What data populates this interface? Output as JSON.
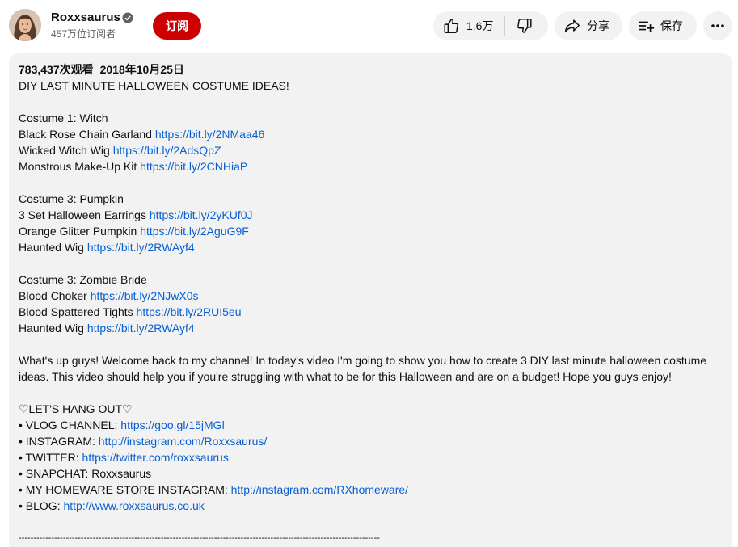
{
  "channel": {
    "name": "Roxxsaurus",
    "subscribers": "457万位订阅者",
    "subscribe_label": "订阅"
  },
  "actions": {
    "like_count": "1.6万",
    "share_label": "分享",
    "save_label": "保存"
  },
  "description": {
    "views": "783,437次观看",
    "date": "2018年10月25日",
    "headline": "DIY LAST MINUTE HALLOWEEN COSTUME IDEAS!",
    "section1": {
      "title": "Costume 1: Witch",
      "items": [
        {
          "text": "Black Rose Chain Garland",
          "link": "https://bit.ly/2NMaa46"
        },
        {
          "text": "Wicked Witch Wig",
          "link": "https://bit.ly/2AdsQpZ"
        },
        {
          "text": "Monstrous Make-Up Kit",
          "link": "https://bit.ly/2CNHiaP"
        }
      ]
    },
    "section2": {
      "title": "Costume 3: Pumpkin",
      "items": [
        {
          "text": "3 Set Halloween Earrings",
          "link": "https://bit.ly/2yKUf0J"
        },
        {
          "text": "Orange Glitter Pumpkin",
          "link": "https://bit.ly/2AguG9F"
        },
        {
          "text": "Haunted Wig",
          "link": "https://bit.ly/2RWAyf4"
        }
      ]
    },
    "section3": {
      "title": "Costume 3: Zombie Bride",
      "items": [
        {
          "text": "Blood Choker",
          "link": "https://bit.ly/2NJwX0s"
        },
        {
          "text": "Blood Spattered Tights",
          "link": "https://bit.ly/2RUI5eu"
        },
        {
          "text": "Haunted Wig",
          "link": "https://bit.ly/2RWAyf4"
        }
      ]
    },
    "intro": "What's up guys! Welcome back to my channel! In today's video I'm going to show you how to create 3 DIY last minute halloween costume ideas. This video should help you if you're struggling with what to be for this Halloween and are on a budget! Hope you guys enjoy!",
    "hangout_title": "♡LET'S HANG OUT♡",
    "socials": [
      {
        "text": "• VLOG CHANNEL:",
        "link": "https://goo.gl/15jMGl"
      },
      {
        "text": "• INSTAGRAM:",
        "link": "http://instagram.com/Roxxsaurus/"
      },
      {
        "text": "• TWITTER:",
        "link": "https://twitter.com/roxxsaurus"
      },
      {
        "text": "• SNAPCHAT: Roxxsaurus",
        "link": ""
      },
      {
        "text": "• MY HOMEWARE STORE INSTAGRAM:",
        "link": "http://instagram.com/RXhomeware/"
      },
      {
        "text": "• BLOG:",
        "link": "http://www.roxxsaurus.co.uk"
      }
    ],
    "divider": "--------------------------------------------------------------------------------------------------------------------------"
  },
  "icons": {
    "verified": "verified-check-icon",
    "like": "thumbs-up-icon",
    "dislike": "thumbs-down-icon",
    "share": "share-arrow-icon",
    "save": "playlist-add-icon",
    "more": "more-horizontal-icon"
  },
  "colors": {
    "subscribe": "#cc0000",
    "link": "#065fd4",
    "panel": "#f2f2f2"
  }
}
